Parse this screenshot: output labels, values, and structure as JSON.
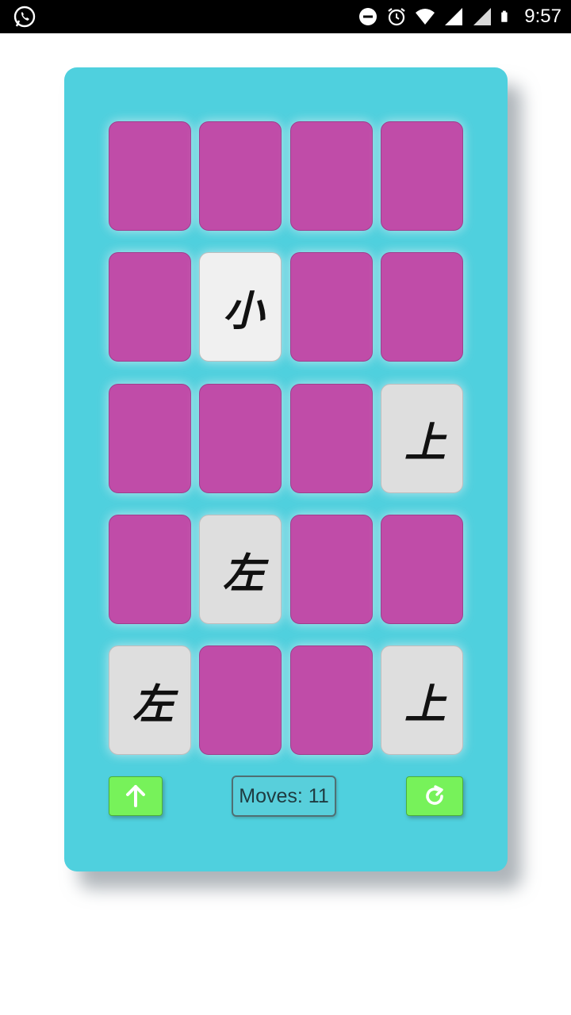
{
  "status_bar": {
    "time": "9:57",
    "left_icon": "whatsapp-icon",
    "right_icons": [
      "do-not-disturb-icon",
      "alarm-icon",
      "wifi-icon",
      "signal-icon",
      "signal-icon",
      "battery-icon"
    ]
  },
  "board": {
    "background_color": "#4fd0de",
    "card_back_color": "#c04ca8",
    "card_face_color": "#dedede",
    "cards": [
      {
        "state": "hidden",
        "char": ""
      },
      {
        "state": "hidden",
        "char": ""
      },
      {
        "state": "hidden",
        "char": ""
      },
      {
        "state": "hidden",
        "char": ""
      },
      {
        "state": "hidden",
        "char": ""
      },
      {
        "state": "revealed",
        "char": "小"
      },
      {
        "state": "hidden",
        "char": ""
      },
      {
        "state": "hidden",
        "char": ""
      },
      {
        "state": "hidden",
        "char": ""
      },
      {
        "state": "hidden",
        "char": ""
      },
      {
        "state": "hidden",
        "char": ""
      },
      {
        "state": "revealed",
        "char": "上"
      },
      {
        "state": "hidden",
        "char": ""
      },
      {
        "state": "revealed",
        "char": "左"
      },
      {
        "state": "hidden",
        "char": ""
      },
      {
        "state": "hidden",
        "char": ""
      },
      {
        "state": "revealed",
        "char": "左"
      },
      {
        "state": "hidden",
        "char": ""
      },
      {
        "state": "hidden",
        "char": ""
      },
      {
        "state": "revealed",
        "char": "上"
      }
    ]
  },
  "controls": {
    "up_icon": "arrow-up-icon",
    "restart_icon": "restart-icon",
    "moves_label": "Moves: 11",
    "button_color": "#77f25a"
  }
}
